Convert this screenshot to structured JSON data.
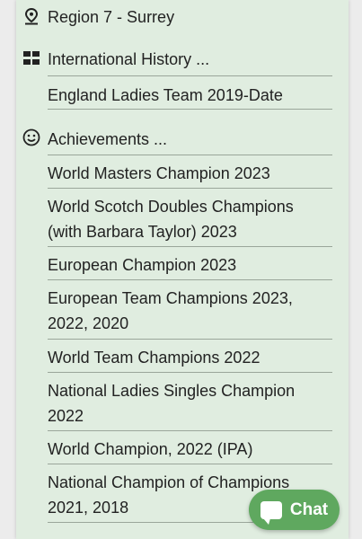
{
  "region": {
    "icon": "location-pin-icon",
    "label": "Region 7 - Surrey"
  },
  "international": {
    "icon": "grid-icon",
    "heading": "International History ...",
    "items": [
      "England Ladies Team 2019-Date"
    ]
  },
  "achievements": {
    "icon": "smiley-face-icon",
    "heading": "Achievements ...",
    "items": [
      [
        "World Masters Champion 2023"
      ],
      [
        "World Scotch Doubles Champions",
        "(with Barbara Taylor) 2023"
      ],
      [
        "European Champion 2023"
      ],
      [
        "European Team Champions 2023,",
        "2022, 2020"
      ],
      [
        "World Team Champions 2022"
      ],
      [
        "National Ladies Singles Champion",
        "2022"
      ],
      [
        "World Champion, 2022 (IPA)"
      ],
      [
        "National Champion of Champions",
        "2021, 2018"
      ]
    ]
  },
  "chat": {
    "label": "Chat",
    "icon": "chat-bubble-icon"
  },
  "colors": {
    "panel_bg": "#e0ede0",
    "chat_bg": "#5fa85f",
    "divider": "#9aa69a"
  }
}
